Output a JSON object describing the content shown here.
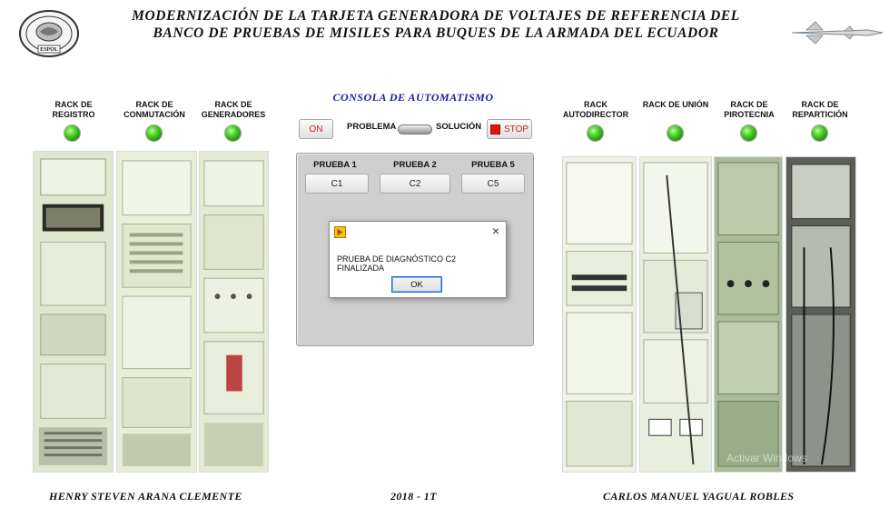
{
  "header": {
    "title_line1": "MODERNIZACIÓN DE LA TARJETA GENERADORA DE VOLTAJES DE REFERENCIA DEL",
    "title_line2": "BANCO DE PRUEBAS DE MISILES PARA BUQUES DE LA ARMADA DEL ECUADOR",
    "logo_text": "ESPOL"
  },
  "left_racks": [
    {
      "label": "RACK DE REGISTRO",
      "status_color": "#3cc21e"
    },
    {
      "label": "RACK DE CONMUTACIÓN",
      "status_color": "#3cc21e"
    },
    {
      "label": "RACK DE GENERADORES",
      "status_color": "#3cc21e"
    }
  ],
  "right_racks": [
    {
      "label": "RACK AUTODIRECTOR",
      "status_color": "#3cc21e"
    },
    {
      "label": "RACK DE UNIÓN",
      "status_color": "#3cc21e"
    },
    {
      "label": "RACK DE PIROTECNIA",
      "status_color": "#3cc21e"
    },
    {
      "label": "RACK DE REPARTICIÓN",
      "status_color": "#3cc21e"
    }
  ],
  "console": {
    "title": "CONSOLA DE AUTOMATISMO",
    "on_label": "ON",
    "problema_label": "PROBLEMA",
    "solucion_label": "SOLUCIÓN",
    "stop_label": "STOP",
    "pruebas": [
      {
        "label": "PRUEBA 1",
        "button": "C1"
      },
      {
        "label": "PRUEBA 2",
        "button": "C2"
      },
      {
        "label": "PRUEBA 5",
        "button": "C5"
      }
    ]
  },
  "dialog": {
    "close_glyph": "×",
    "message": "PRUEBA DE DIAGNÓSTICO C2 FINALIZADA",
    "ok_label": "OK"
  },
  "watermark": "Activar Windows",
  "footer": {
    "author_left": "HENRY STEVEN ARANA CLEMENTE",
    "term": "2018 - 1T",
    "author_right": "CARLOS MANUEL YAGUAL ROBLES"
  }
}
